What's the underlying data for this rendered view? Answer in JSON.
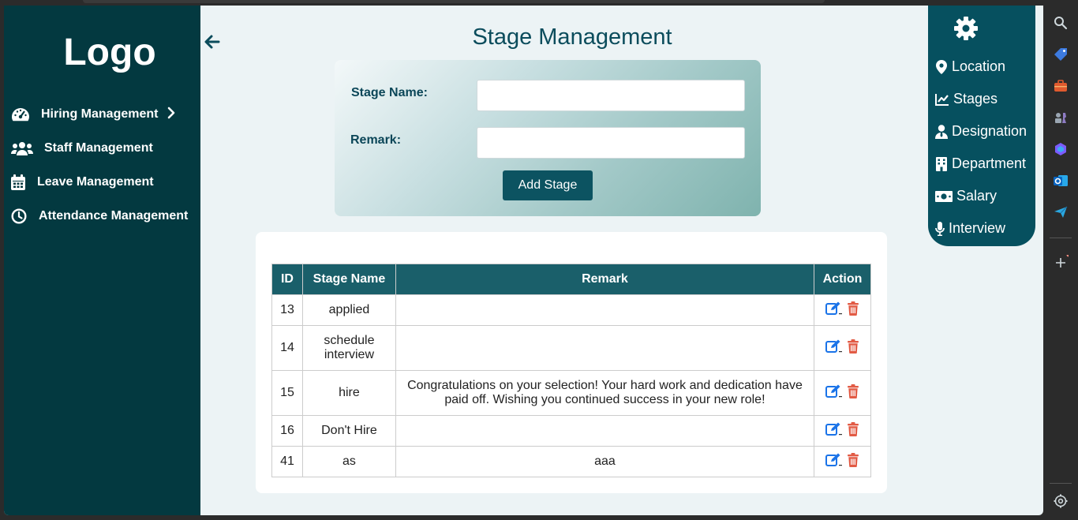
{
  "sidebar": {
    "logo": "Logo",
    "items": [
      {
        "label": "Hiring Management",
        "icon": "gauge-icon"
      },
      {
        "label": "Staff Management",
        "icon": "users-icon"
      },
      {
        "label": "Leave Management",
        "icon": "calendar-icon"
      },
      {
        "label": "Attendance Management",
        "icon": "clock-icon"
      }
    ]
  },
  "page": {
    "title": "Stage Management"
  },
  "form": {
    "stage_name_label": "Stage Name:",
    "stage_name_value": "",
    "remark_label": "Remark:",
    "remark_value": "",
    "add_button_label": "Add Stage"
  },
  "table": {
    "headers": [
      "ID",
      "Stage Name",
      "Remark",
      "Action"
    ],
    "rows": [
      {
        "id": "13",
        "name": "applied",
        "remark": ""
      },
      {
        "id": "14",
        "name": "schedule interview",
        "remark": ""
      },
      {
        "id": "15",
        "name": "hire",
        "remark": "Congratulations on your selection! Your hard work and dedication have paid off. Wishing you continued success in your new role!"
      },
      {
        "id": "16",
        "name": "Don't Hire",
        "remark": ""
      },
      {
        "id": "41",
        "name": "as",
        "remark": "aaa"
      }
    ]
  },
  "right_menu": {
    "items": [
      {
        "label": "Location",
        "icon": "map-pin-icon"
      },
      {
        "label": "Stages",
        "icon": "chart-line-icon"
      },
      {
        "label": "Designation",
        "icon": "user-tie-icon"
      },
      {
        "label": "Department",
        "icon": "building-icon"
      },
      {
        "label": "Salary",
        "icon": "money-bill-icon"
      },
      {
        "label": "Interview",
        "icon": "microphone-icon"
      }
    ]
  },
  "colors": {
    "sidebar_bg": "#033940",
    "title": "#0b4c5c",
    "table_header": "#1a5f6a",
    "edit_icon": "#1a73e8",
    "delete_icon": "#e25b45"
  }
}
